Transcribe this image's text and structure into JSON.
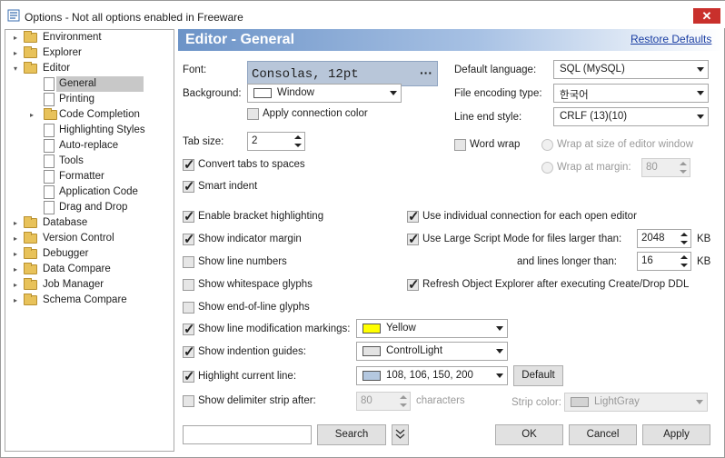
{
  "window": {
    "title": "Options - Not all options enabled in Freeware",
    "close_glyph": "✕"
  },
  "tree": {
    "items": [
      {
        "label": "Environment",
        "expander": "▸",
        "icon": "folder-icon"
      },
      {
        "label": "Explorer",
        "expander": "▸",
        "icon": "folder-icon"
      },
      {
        "label": "Editor",
        "expander": "▾",
        "icon": "folder-icon"
      },
      {
        "label": "General",
        "icon": "page-icon",
        "selected": true
      },
      {
        "label": "Printing",
        "icon": "page-icon"
      },
      {
        "label": "Code Completion",
        "expander": "▸",
        "icon": "folder-icon"
      },
      {
        "label": "Highlighting Styles",
        "icon": "page-icon"
      },
      {
        "label": "Auto-replace",
        "icon": "page-icon"
      },
      {
        "label": "Tools",
        "icon": "page-icon"
      },
      {
        "label": "Formatter",
        "icon": "page-icon"
      },
      {
        "label": "Application Code",
        "icon": "page-icon"
      },
      {
        "label": "Drag and Drop",
        "icon": "page-icon"
      },
      {
        "label": "Database",
        "expander": "▸",
        "icon": "folder-icon"
      },
      {
        "label": "Version Control",
        "expander": "▸",
        "icon": "folder-icon"
      },
      {
        "label": "Debugger",
        "expander": "▸",
        "icon": "folder-icon"
      },
      {
        "label": "Data Compare",
        "expander": "▸",
        "icon": "folder-icon"
      },
      {
        "label": "Job Manager",
        "expander": "▸",
        "icon": "folder-icon"
      },
      {
        "label": "Schema Compare",
        "expander": "▸",
        "icon": "folder-icon"
      }
    ]
  },
  "header": {
    "title": "Editor - General",
    "restore_link": "Restore Defaults"
  },
  "font": {
    "label": "Font:",
    "value": "Consolas, 12pt",
    "browse": "···"
  },
  "background": {
    "label": "Background:",
    "value": "Window",
    "swatch_color": "#ffffff"
  },
  "apply_connection_color": {
    "label": "Apply connection color",
    "checked": false
  },
  "default_language": {
    "label": "Default language:",
    "value": "SQL (MySQL)"
  },
  "file_encoding": {
    "label": "File encoding type:",
    "value": "한국어"
  },
  "line_end": {
    "label": "Line end style:",
    "value": "CRLF (13)(10)"
  },
  "tab_size": {
    "label": "Tab size:",
    "value": "2"
  },
  "word_wrap": {
    "label": "Word wrap",
    "checked": false
  },
  "wrap_editor": {
    "label": "Wrap at size of editor window"
  },
  "wrap_margin": {
    "label": "Wrap at margin:",
    "value": "80"
  },
  "checks_left": {
    "convert_tabs": {
      "label": "Convert tabs to spaces",
      "checked": true
    },
    "smart_indent": {
      "label": "Smart indent",
      "checked": true
    },
    "bracket": {
      "label": "Enable bracket highlighting",
      "checked": true
    },
    "indicator_margin": {
      "label": "Show indicator margin",
      "checked": true
    },
    "line_numbers": {
      "label": "Show line numbers",
      "checked": false
    },
    "whitespace": {
      "label": "Show whitespace glyphs",
      "checked": false
    },
    "eol": {
      "label": "Show end-of-line glyphs",
      "checked": false
    },
    "line_mod": {
      "label": "Show line modification markings:",
      "checked": true
    },
    "indent_guides": {
      "label": "Show indention guides:",
      "checked": true
    },
    "highlight_line": {
      "label": "Highlight current line:",
      "checked": true
    },
    "delimiter": {
      "label": "Show delimiter strip after:",
      "checked": false
    }
  },
  "checks_right": {
    "individual_conn": {
      "label": "Use individual connection for each open editor",
      "checked": true
    },
    "large_script": {
      "label": "Use Large Script Mode for files larger than:",
      "checked": true
    },
    "refresh_oe": {
      "label": "Refresh Object Explorer after executing Create/Drop DDL",
      "checked": true
    }
  },
  "large_script": {
    "size_value": "2048",
    "size_unit": "KB",
    "lines_label": "and lines longer than:",
    "lines_value": "16",
    "lines_unit": "KB"
  },
  "line_mod_color": {
    "value": "Yellow",
    "swatch_color": "#ffff00"
  },
  "indent_color": {
    "value": "ControlLight",
    "swatch_color": "#e3e3e3"
  },
  "highlight_color": {
    "value": "108, 106, 150, 200",
    "swatch_color": "#b4c8e0",
    "default_button": "Default"
  },
  "delimiter": {
    "value": "80",
    "unit": "characters",
    "strip_label": "Strip color:",
    "strip_value": "LightGray",
    "strip_swatch": "#d3d3d3"
  },
  "bottom": {
    "search_placeholder": "",
    "search_button": "Search",
    "ok": "OK",
    "cancel": "Cancel",
    "apply": "Apply"
  }
}
